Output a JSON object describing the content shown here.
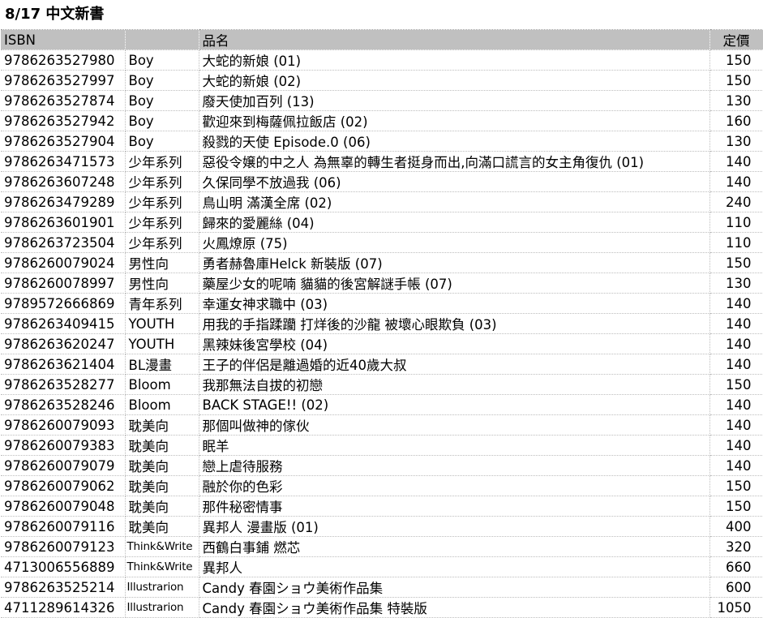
{
  "title": "8/17 中文新書",
  "headers": {
    "isbn": "ISBN",
    "category": "",
    "name": "品名",
    "price": "定價"
  },
  "rows": [
    {
      "isbn": "9786263527980",
      "category": "Boy",
      "name": "大蛇的新娘 (01)",
      "price": "150"
    },
    {
      "isbn": "9786263527997",
      "category": "Boy",
      "name": "大蛇的新娘 (02)",
      "price": "150"
    },
    {
      "isbn": "9786263527874",
      "category": "Boy",
      "name": "廢天使加百列 (13)",
      "price": "130"
    },
    {
      "isbn": "9786263527942",
      "category": "Boy",
      "name": "歡迎來到梅薩佩拉飯店 (02)",
      "price": "160"
    },
    {
      "isbn": "9786263527904",
      "category": "Boy",
      "name": "殺戮的天使 Episode.0 (06)",
      "price": "130"
    },
    {
      "isbn": "9786263471573",
      "category": "少年系列",
      "name": "惡役令嬢的中之人 為無辜的轉生者挺身而出,向滿口謊言的女主角復仇 (01)",
      "price": "140"
    },
    {
      "isbn": "9786263607248",
      "category": "少年系列",
      "name": "久保同學不放過我 (06)",
      "price": "140"
    },
    {
      "isbn": "9786263479289",
      "category": "少年系列",
      "name": "鳥山明 滿漢全席 (02)",
      "price": "240"
    },
    {
      "isbn": "9786263601901",
      "category": "少年系列",
      "name": "歸來的愛麗絲 (04)",
      "price": "110"
    },
    {
      "isbn": "9786263723504",
      "category": "少年系列",
      "name": "火鳳燎原 (75)",
      "price": "110"
    },
    {
      "isbn": "9786260079024",
      "category": "男性向",
      "name": "勇者赫魯庫Helck 新裝版 (07)",
      "price": "150"
    },
    {
      "isbn": "9786260078997",
      "category": "男性向",
      "name": "藥屋少女的呢喃 貓貓的後宮解謎手帳 (07)",
      "price": "130"
    },
    {
      "isbn": "9789572666869",
      "category": "青年系列",
      "name": "幸運女神求職中 (03)",
      "price": "140"
    },
    {
      "isbn": "9786263409415",
      "category": "YOUTH",
      "name": "用我的手指蹂躪 打烊後的沙龍 被壞心眼欺負 (03)",
      "price": "140"
    },
    {
      "isbn": "9786263620247",
      "category": "YOUTH",
      "name": "黑辣妹後宮學校 (04)",
      "price": "140"
    },
    {
      "isbn": "9786263621404",
      "category": "BL漫畫",
      "name": "王子的伴侶是離過婚的近40歲大叔",
      "price": "140"
    },
    {
      "isbn": "9786263528277",
      "category": "Bloom",
      "name": "我那無法自拔的初戀",
      "price": "150"
    },
    {
      "isbn": "9786263528246",
      "category": "Bloom",
      "name": "BACK STAGE!! (02)",
      "price": "140"
    },
    {
      "isbn": "9786260079093",
      "category": "耽美向",
      "name": "那個叫做神的傢伙",
      "price": "140"
    },
    {
      "isbn": "9786260079383",
      "category": "耽美向",
      "name": "眠羊",
      "price": "140"
    },
    {
      "isbn": "9786260079079",
      "category": "耽美向",
      "name": "戀上虐待服務",
      "price": "140"
    },
    {
      "isbn": "9786260079062",
      "category": "耽美向",
      "name": "融於你的色彩",
      "price": "150"
    },
    {
      "isbn": "9786260079048",
      "category": "耽美向",
      "name": "那件秘密情事",
      "price": "150"
    },
    {
      "isbn": "9786260079116",
      "category": "耽美向",
      "name": "異邦人 漫畫版 (01)",
      "price": "400"
    },
    {
      "isbn": "9786260079123",
      "category": "Think&Write",
      "name": "西鶴白事鋪 燃芯",
      "price": "320"
    },
    {
      "isbn": "4713006556889",
      "category": "Think&Write",
      "name": "異邦人",
      "price": "660"
    },
    {
      "isbn": "9786263525214",
      "category": "Illustrarion",
      "name": "Candy 春園ショウ美術作品集",
      "price": "600"
    },
    {
      "isbn": "4711289614326",
      "category": "Illustrarion",
      "name": "Candy 春園ショウ美術作品集 特裝版",
      "price": "1050"
    }
  ]
}
